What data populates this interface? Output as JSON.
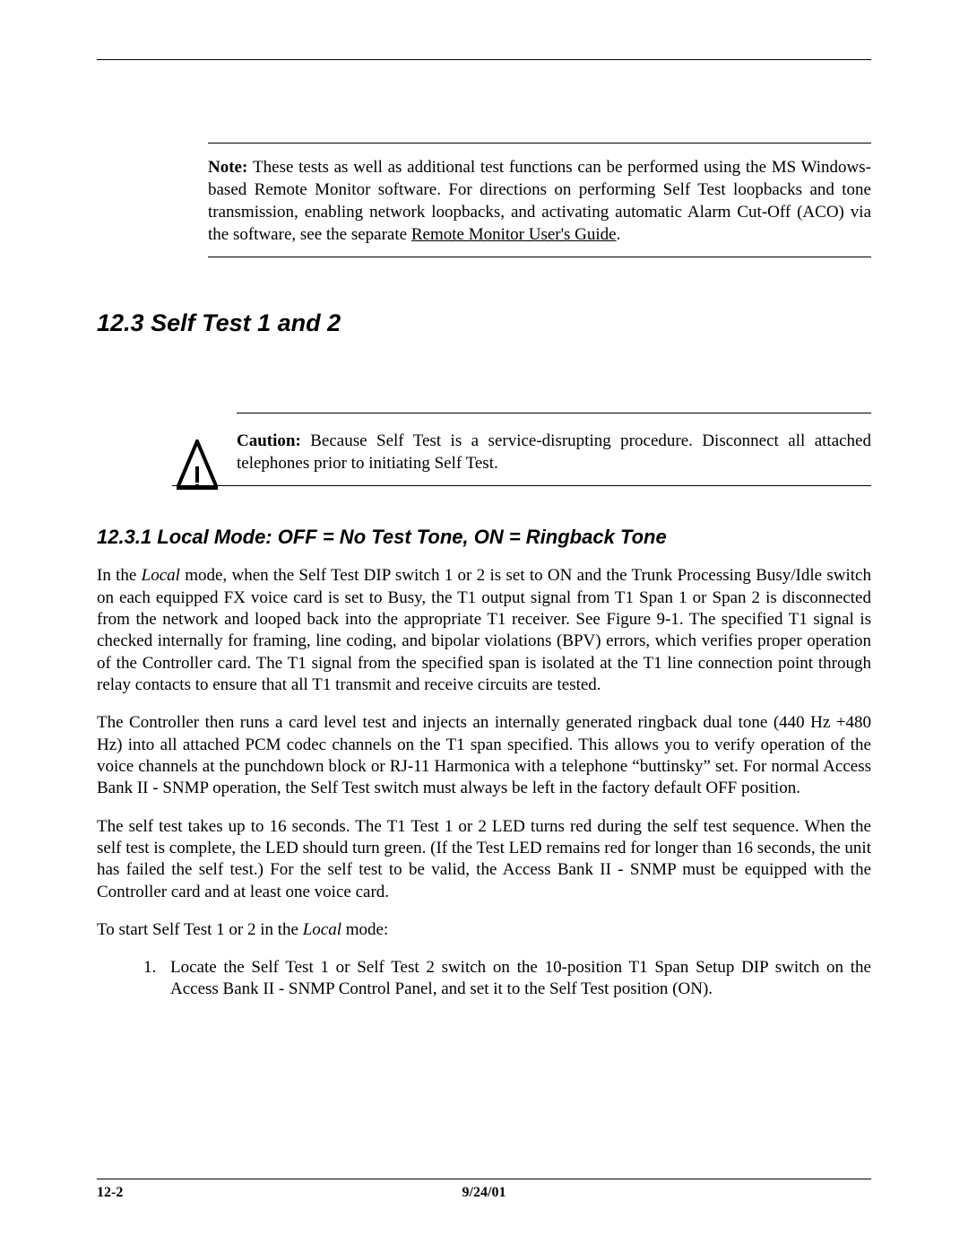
{
  "note": {
    "label": "Note:",
    "text_before_link": "These tests as well as additional test functions can be performed using the MS Windows-based Remote Monitor software. For directions on performing Self Test loopbacks and tone transmission, enabling network loopbacks, and activating automatic Alarm Cut-Off (ACO) via the software, see the separate ",
    "link_text": "Remote Monitor User's Guide",
    "text_after_link": "."
  },
  "section": {
    "number": "12.3",
    "title": "Self Test 1 and 2"
  },
  "caution": {
    "label": "Caution:",
    "text": "Because Self Test is a service-disrupting procedure. Disconnect all attached telephones prior to initiating Self Test."
  },
  "subsection": {
    "number": "12.3.1",
    "title": "Local Mode: OFF = No Test Tone, ON = Ringback Tone"
  },
  "p1": {
    "before_italic": "In the ",
    "italic": "Local",
    "after_italic": " mode, when the Self Test DIP switch 1 or 2 is set to ON and the Trunk Processing Busy/Idle switch on each equipped FX voice card is set to Busy, the T1 output signal from T1 Span 1 or Span 2 is disconnected from the network and looped back into the appropriate T1 receiver. See Figure 9-1. The specified T1 signal is checked internally for framing, line coding, and bipolar violations (BPV) errors, which verifies proper operation of the Controller card. The T1 signal from the specified span is isolated at the T1 line connection point through relay contacts to ensure that all T1 transmit and receive circuits are tested."
  },
  "p2": "The Controller then runs a card level test and injects an internally generated ringback dual tone (440 Hz +480 Hz) into all attached PCM codec channels on the T1 span specified. This allows you to verify operation of the voice channels at the punchdown block or RJ-11 Harmonica with a telephone “buttinsky” set. For normal Access Bank II - SNMP operation, the Self Test switch must always be left in the factory default OFF position.",
  "p3": "The self test takes up to 16 seconds. The T1 Test 1 or 2 LED turns red during the self test sequence. When the self test is complete, the LED should turn green. (If the Test LED remains red for longer than 16 seconds, the unit has failed the self test.) For the self test to be valid, the Access Bank II - SNMP must be equipped with the Controller card and at least one voice card.",
  "p4": {
    "before_italic": "To start Self Test 1 or 2 in the ",
    "italic": "Local",
    "after_italic": " mode:"
  },
  "steps": [
    {
      "num": "1.",
      "text": "Locate the Self Test 1 or Self Test 2 switch on the 10-position T1 Span Setup DIP switch on the Access Bank II - SNMP Control Panel, and set it to the Self Test position (ON)."
    }
  ],
  "footer": {
    "page": "12-2",
    "date": "9/24/01"
  }
}
